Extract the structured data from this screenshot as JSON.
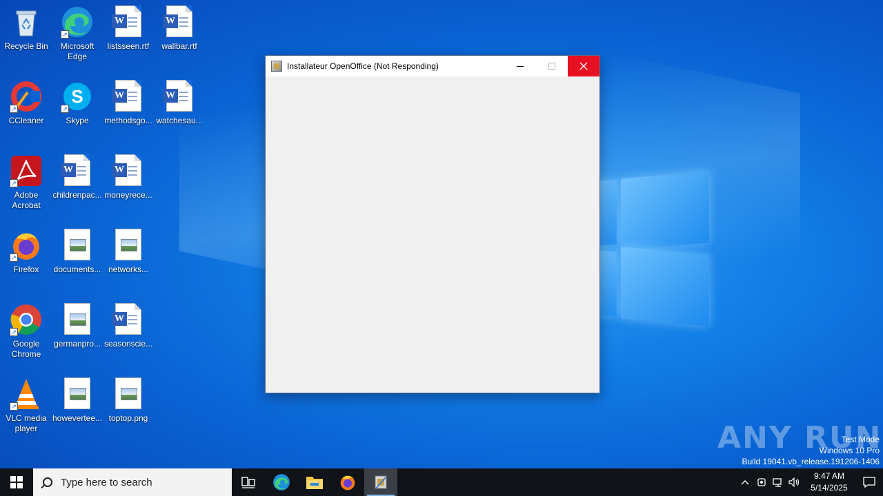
{
  "desktop": {
    "icons": [
      {
        "label": "Recycle Bin",
        "type": "recycle"
      },
      {
        "label": "Microsoft Edge",
        "type": "edge"
      },
      {
        "label": "listsseen.rtf",
        "type": "word"
      },
      {
        "label": "wallbar.rtf",
        "type": "word"
      },
      {
        "label": "CCleaner",
        "type": "ccleaner"
      },
      {
        "label": "Skype",
        "type": "skype"
      },
      {
        "label": "methodsgo...",
        "type": "word"
      },
      {
        "label": "watchesau...",
        "type": "word"
      },
      {
        "label": "Adobe Acrobat",
        "type": "acrobat"
      },
      {
        "label": "childrenpac...",
        "type": "word"
      },
      {
        "label": "moneyrece...",
        "type": "word"
      },
      {
        "label": "Firefox",
        "type": "firefox"
      },
      {
        "label": "documents...",
        "type": "image"
      },
      {
        "label": "networks...",
        "type": "image"
      },
      {
        "label": "Google Chrome",
        "type": "chrome"
      },
      {
        "label": "germanpro...",
        "type": "image"
      },
      {
        "label": "seasonscie...",
        "type": "word"
      },
      {
        "label": "VLC media player",
        "type": "vlc"
      },
      {
        "label": "howevertee...",
        "type": "image"
      },
      {
        "label": "toptop.png",
        "type": "image"
      }
    ]
  },
  "window": {
    "title": "Installateur OpenOffice  (Not Responding)",
    "icon": "installer-icon",
    "controls": {
      "minimize": "minimize-icon",
      "maximize": "maximize-icon",
      "close": "close-icon"
    }
  },
  "watermark": {
    "brand": "ANY RUN",
    "test_mode": "Test Mode",
    "edition": "Windows 10 Pro",
    "build": "Build 19041.vb_release.191206-1406"
  },
  "taskbar": {
    "search_placeholder": "Type here to search",
    "apps": [
      "task-view-icon",
      "edge-icon",
      "file-explorer-icon",
      "firefox-icon",
      "installer-icon"
    ],
    "active_app": "installer-icon",
    "clock_time": "9:47 AM",
    "clock_date": "5/14/2025"
  },
  "colors": {
    "accent": "#0a63d3",
    "close_red": "#e81123",
    "taskbar": "#101418"
  }
}
